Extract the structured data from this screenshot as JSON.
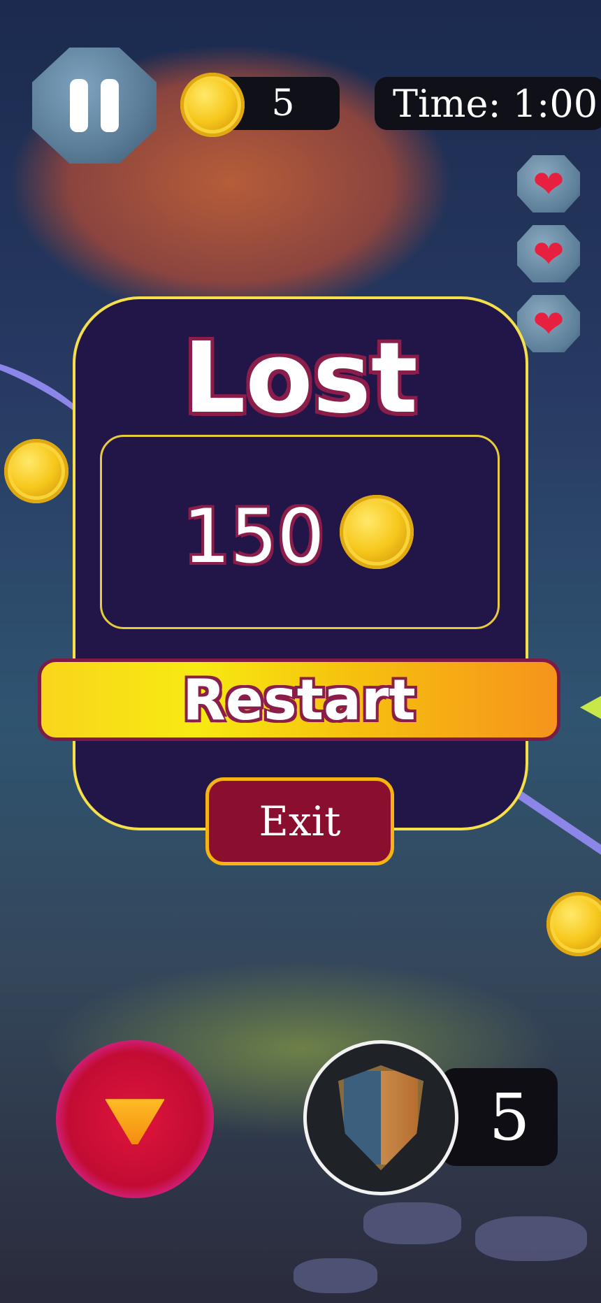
{
  "hud": {
    "coins": "5",
    "timer": "Time: 1:00",
    "lives": 3
  },
  "icons": {
    "pause": "pause-icon",
    "coin": "coin-icon",
    "heart": "heart-icon",
    "shield": "shield-icon"
  },
  "dialog": {
    "title": "Lost",
    "score": "150",
    "restart_label": "Restart",
    "exit_label": "Exit"
  },
  "powerups": {
    "shield_count": "5"
  },
  "colors": {
    "panel_bg": "#221548",
    "panel_border": "#f6e04a",
    "text_outline": "#8a1d4a",
    "exit_bg": "#8a0f2e",
    "exit_border": "#f6b413"
  }
}
